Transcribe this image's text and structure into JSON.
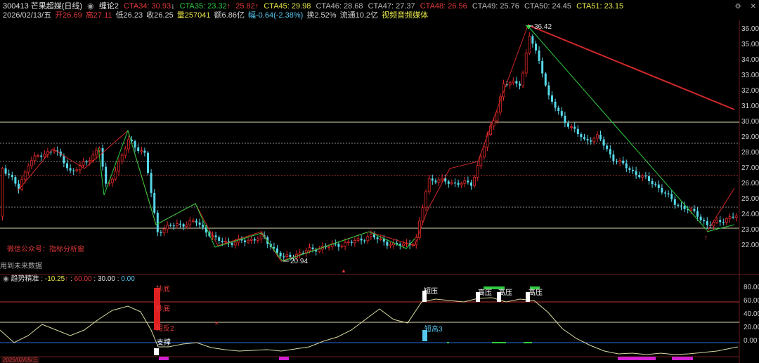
{
  "header": {
    "code_name": "300413 芒果超媒(日线)",
    "indicator_name": "缠论2",
    "cta34": "CTA34: 30.93",
    "cta34_arrow": "↓",
    "cta35": "CTA35: 23.32",
    "cta35_arrow": "↑",
    "cta36": "25.82",
    "cta36_arrow": "↑",
    "cta45": "CTA45: 29.98",
    "cta46": "CTA46: 28.68",
    "cta47": "CTA47: 27.37",
    "cta48": "CTA48: 26.56",
    "cta49": "CTA49: 25.76",
    "cta50": "CTA50: 24.45",
    "cta51": "CTA51: 23.15"
  },
  "quote": {
    "date": "2026/02/13/五",
    "open": "开26.69",
    "high": "高27.11",
    "low": "低26.23",
    "close": "收26.25",
    "volume": "量257041",
    "amount": "额6.86亿",
    "change": "幅-0.64(-2.38%)",
    "turnover": "换2.52%",
    "float": "流通10.2亿",
    "sector": "视频音频媒体"
  },
  "main_chart": {
    "high_label": "36.42",
    "low_label": "20.94",
    "watermark": "微信公众号：指标分析窗",
    "future_note": "用到未来数据",
    "y_ticks": [
      "36.00",
      "35.00",
      "34.00",
      "33.00",
      "32.00",
      "31.00",
      "30.00",
      "29.00",
      "28.00",
      "27.00",
      "26.00",
      "25.00",
      "24.00",
      "23.00",
      "22.00"
    ]
  },
  "sub_chart": {
    "title": "趋势精准",
    "v1": "-10.25",
    "v1_arrow": "↑",
    "v2": "60.00",
    "v3": "30.00",
    "v4": "0.00",
    "y_ticks": [
      "80.00",
      "60.00",
      "40.00",
      "20.00",
      "0.00"
    ],
    "labels": {
      "dibao": "抄底",
      "dichou": "抄底",
      "fantan2": "短反2",
      "zhicheng": "支撑",
      "duanya": "短压",
      "gaoya1": "高压",
      "gaoya2": "高压",
      "gaoya3": "高压",
      "duangao3": "短高3"
    }
  },
  "footer": {
    "date_label": "2025/02/05/三"
  },
  "colors": {
    "red": "#e23a3a",
    "green": "#2ecc40",
    "cyan": "#56c8f0",
    "yellow": "#e8e84a",
    "magenta": "#d020d0"
  }
}
